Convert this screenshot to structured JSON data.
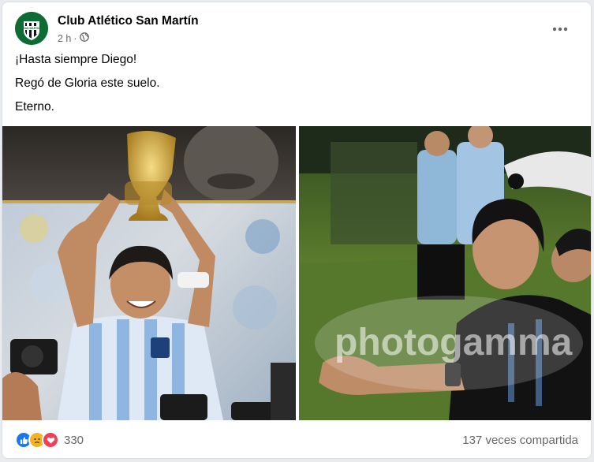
{
  "post": {
    "page_name": "Club Atlético San Martín",
    "avatar_text": "SAN MARTIN",
    "time": "2 h",
    "privacy_icon": "globe-icon",
    "more_icon": "more-dots-icon",
    "lines": [
      "¡Hasta siempre Diego!",
      "Regó de Gloria este suelo.",
      "Eterno."
    ]
  },
  "photos": {
    "left_alt": "Diego Maradona levantando la copa del mundo",
    "right_watermark": "photogamma"
  },
  "footer": {
    "reaction_icons": [
      "like-icon",
      "sad-icon",
      "love-icon"
    ],
    "reaction_count": "330",
    "shares": "137 veces compartida"
  },
  "colors": {
    "brand_green": "#0e6b34",
    "secondary_text": "#65676b",
    "like_blue": "#1877f2",
    "sad_yellow": "#f7b125",
    "love_red": "#f33e58"
  }
}
